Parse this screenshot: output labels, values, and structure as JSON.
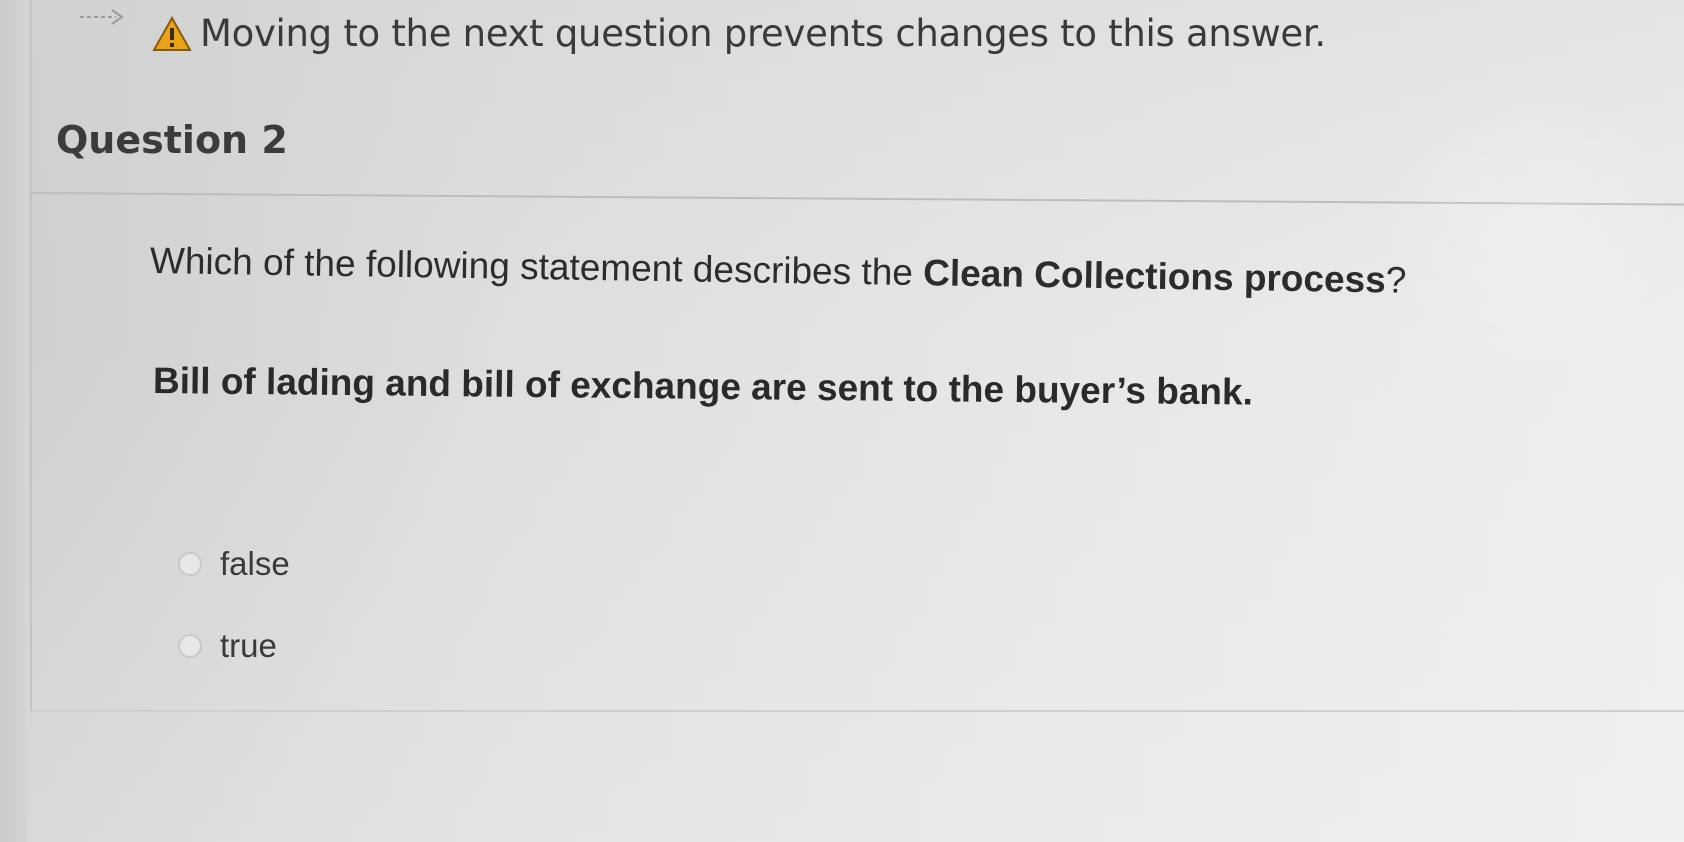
{
  "warning": {
    "text": "Moving to the next question prevents changes to this answer.",
    "icon": "warning-triangle-icon",
    "icon_color": "#e8a317"
  },
  "question": {
    "title": "Question 2",
    "prompt_prefix": "Which of the following statement describes the ",
    "prompt_bold": "Clean Collections process",
    "prompt_suffix": "?",
    "statement": "Bill of lading and bill of exchange are sent to the buyer’s bank."
  },
  "options": [
    {
      "label": "false",
      "selected": false
    },
    {
      "label": "true",
      "selected": false
    }
  ]
}
